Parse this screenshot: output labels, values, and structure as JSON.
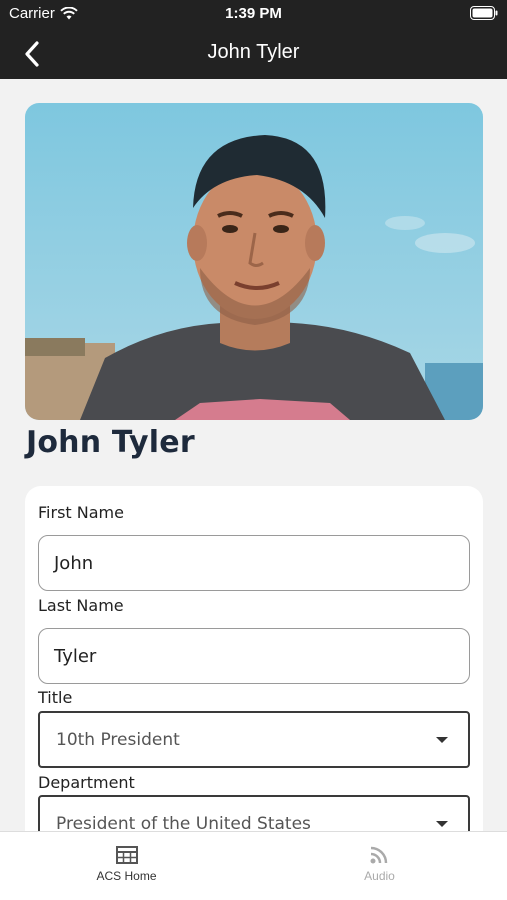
{
  "status_bar": {
    "carrier": "Carrier",
    "time": "1:39 PM"
  },
  "nav": {
    "title": "John Tyler",
    "back_icon": "chevron-left-icon"
  },
  "profile": {
    "name": "John Tyler",
    "photo_description": "portrait-photo"
  },
  "form": {
    "first_name": {
      "label": "First Name",
      "value": "John"
    },
    "last_name": {
      "label": "Last Name",
      "value": "Tyler"
    },
    "title": {
      "label": "Title",
      "value": "10th President"
    },
    "department": {
      "label": "Department",
      "value": "President of the United States"
    }
  },
  "tabs": [
    {
      "label": "ACS Home",
      "icon": "table-icon",
      "active": true
    },
    {
      "label": "Audio",
      "icon": "rss-icon",
      "active": false
    }
  ],
  "colors": {
    "header": "#222222",
    "name_text": "#1e2a3c",
    "background": "#f2f2f2"
  }
}
